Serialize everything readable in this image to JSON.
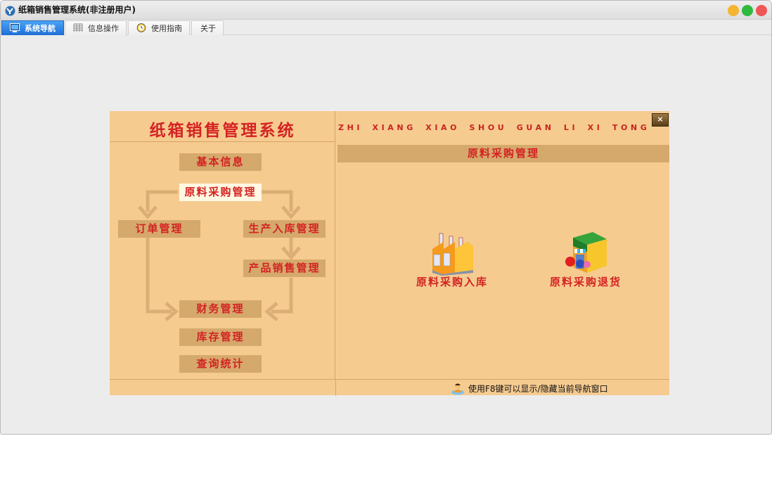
{
  "window": {
    "title": "纸箱销售管理系统(非注册用户)",
    "controls": {
      "minimize_color": "#f4b531",
      "maximize_color": "#2fba3f",
      "close_color": "#ef5656"
    }
  },
  "tabs": [
    {
      "label": "系统导航",
      "icon": "monitor-icon",
      "active": true
    },
    {
      "label": "信息操作",
      "icon": "grid-icon",
      "active": false
    },
    {
      "label": "使用指南",
      "icon": "clock-icon",
      "active": false
    },
    {
      "label": "关于",
      "icon": "",
      "active": false
    }
  ],
  "panel": {
    "title": "纸箱销售管理系统",
    "pinyin": "ZHI XIANG XIAO SHOU GUAN LI XI TONG",
    "close_label": "×",
    "nav": {
      "basic_info": "基本信息",
      "raw_purchase": "原料采购管理",
      "orders": "订单管理",
      "production_in": "生产入库管理",
      "product_sales": "产品销售管理",
      "finance": "财务管理",
      "inventory": "库存管理",
      "query_stats": "查询统计"
    },
    "active_nav": "raw_purchase",
    "section_title": "原料采购管理",
    "actions": [
      {
        "label": "原料采购入库",
        "icon": "factory-icon"
      },
      {
        "label": "原料采购退货",
        "icon": "shop-icon"
      }
    ],
    "footer_hint": "使用F8键可以显示/隐藏当前导航窗口",
    "colors": {
      "background": "#f6cb90",
      "button": "#d5a96c",
      "text_red": "#d42222",
      "active_button": "#fff8e2"
    }
  }
}
